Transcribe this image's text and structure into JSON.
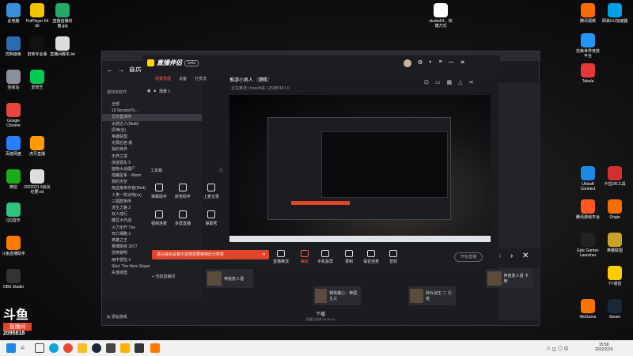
{
  "desktop": {
    "icons_left": [
      {
        "label": "此电脑",
        "color": "#3b8fd9"
      },
      {
        "label": "控制面板",
        "color": "#2b6cb0"
      },
      {
        "label": "回收站",
        "color": "#8a8f99"
      },
      {
        "label": "Google Chrome",
        "color": "#e8463a"
      },
      {
        "label": "百度网盘",
        "color": "#2a7fff"
      },
      {
        "label": "微信",
        "color": "#1aad19"
      },
      {
        "label": "QQ音乐",
        "color": "#31c27c"
      },
      {
        "label": "斗鱼直播助手",
        "color": "#ff7a00"
      },
      {
        "label": "OBS Studio",
        "color": "#333333"
      }
    ],
    "icons_col2": [
      {
        "label": "PotPlayer 64 bit",
        "color": "#f2c400"
      },
      {
        "label": "剪映专业版",
        "color": "#111111"
      },
      {
        "label": "爱奇艺",
        "color": "#00c853"
      },
      {
        "label": "虎牙直播",
        "color": "#ff9900"
      },
      {
        "label": "2022021 9会议纪要.txt",
        "color": "#dddddd"
      }
    ],
    "icons_col3": [
      {
        "label": "直播首播封面.jpg",
        "color": "#22aa66"
      },
      {
        "label": "直播间脚本.txt",
        "color": "#dddddd"
      }
    ],
    "icons_right": [
      {
        "label": "腾讯视频",
        "color": "#ff6a00"
      },
      {
        "label": "完美世界竞技平台",
        "color": "#2196f3"
      },
      {
        "label": "Ubisoft Connect",
        "color": "#1e88e5"
      },
      {
        "label": "腾讯游戏平台",
        "color": "#ff5722"
      },
      {
        "label": "Epic Games Launcher",
        "color": "#222222"
      },
      {
        "label": "WeGame",
        "color": "#ff7300"
      },
      {
        "label": "studio64... 快捷方式",
        "color": "#ffffff"
      },
      {
        "label": "网易UU加速器",
        "color": "#00a0e9"
      },
      {
        "label": "Tabula",
        "color": "#e53935"
      },
      {
        "label": "卡拉OK工具",
        "color": "#d32f2f"
      },
      {
        "label": "Origin",
        "color": "#f56c00"
      },
      {
        "label": "英雄联盟",
        "color": "#c9a227"
      },
      {
        "label": "YY语音",
        "color": "#ffcc00"
      },
      {
        "label": "Steam",
        "color": "#1b2838"
      }
    ]
  },
  "app": {
    "browser_title": "商店",
    "logo_text": "直播伴侣",
    "version": "beta",
    "tabs": [
      "场景管理",
      "设备",
      "打赏流"
    ],
    "scene_label": "场景 1",
    "room_title": "推游小男人",
    "room_badge": "游戏",
    "stats": "正在推流 | boostNE | 2598518 | 0",
    "side_list_header": "游戏库软件",
    "side_list": [
      "全部",
      "10 Second N...",
      "艾尔登法环",
      "太鼓达人(Mobi)",
      "原神(全)",
      "英雄联盟",
      "无限后宫 版",
      "我的世界",
      "无界之境",
      "侠盗猎车 5",
      "植物大战僵尸",
      "猎魔星系 - Warm",
      "我的天空",
      "吸血鬼幸存者(Mod)",
      "人类一败涂地(ru)",
      "三国群英传",
      "求生之路 2",
      "双人成行",
      "糖豆大作战",
      "火力全开 The",
      "死亡细胞 3",
      "英雄之王",
      "赛博朋克 2077",
      "恐怖黎明",
      "雨中冒险 2",
      "Skul: The Hero Slayer",
      "失落城堡"
    ],
    "toolbox_label": "工具箱",
    "tools": [
      {
        "label": "弹幕助手"
      },
      {
        "label": "房管助手"
      },
      {
        "label": "上麦记录"
      },
      {
        "label": "视频连麦"
      },
      {
        "label": "多屏直播"
      },
      {
        "label": "弹幕秀"
      }
    ],
    "tip_text": "请在输出设置中选择您要使用的分辨率",
    "bottom_buttons": [
      {
        "label": "直播推流"
      },
      {
        "label": "美颜"
      },
      {
        "label": "手机投屏"
      },
      {
        "label": "录制"
      },
      {
        "label": "语音连麦"
      },
      {
        "label": "音效"
      }
    ],
    "start_button": "开始直播",
    "status_text": "下播",
    "status_sub": "直播已结束 00:00:00",
    "bottom_left": "添加游戏",
    "add_scene_button": "+ 当前直播间"
  },
  "game_grid": {
    "items": [
      {
        "label": "神兽复人语"
      },
      {
        "label": "钢铁雄心：帝国主义"
      },
      {
        "label": "碎片战王 二 行者"
      },
      {
        "label": "神兽复人语 卡牌"
      }
    ]
  },
  "taskbar": {
    "clock_time": "15:58",
    "clock_date": "2022/2/19"
  },
  "watermark": {
    "brand": "斗鱼",
    "sub": "直播间",
    "id": "2095818"
  }
}
